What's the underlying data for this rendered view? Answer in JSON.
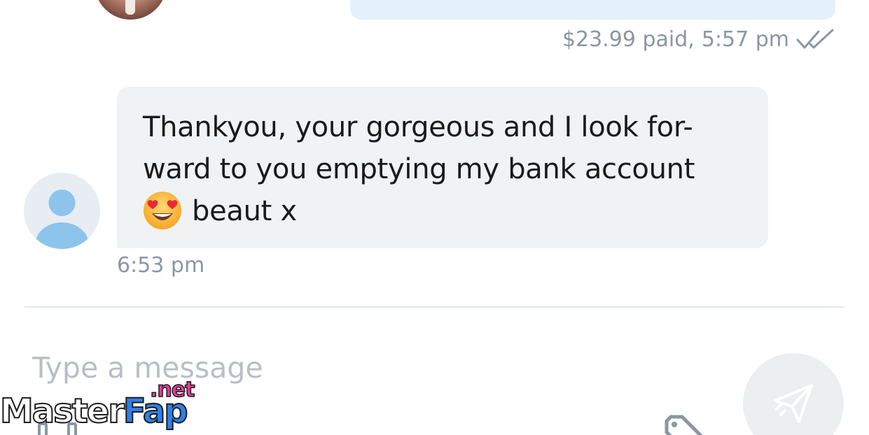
{
  "previous_message": {
    "price_paid": "$23.99 paid,",
    "time": "5:57 pm",
    "status_icon": "double-check-icon"
  },
  "received_message": {
    "lines": [
      "Thankyou, your gorgeous and I look for-",
      "ward to you emptying my bank account",
      "beaut x"
    ],
    "emoji": "heart-eyes-emoji",
    "time": "6:53 pm"
  },
  "composer": {
    "placeholder": "Type a message",
    "value": "",
    "send_icon": "paper-plane-icon",
    "tag_icon": "price-tag-icon"
  },
  "watermark": {
    "main_part1": "Master",
    "main_part2": "Fap",
    "suffix": ".net"
  },
  "colors": {
    "sent_bubble": "#e3f1fb",
    "received_bubble": "#f1f2f4",
    "meta_text": "#8a96a3",
    "placeholder": "#b9bec4",
    "avatar_icon": "#8cc4ec"
  }
}
